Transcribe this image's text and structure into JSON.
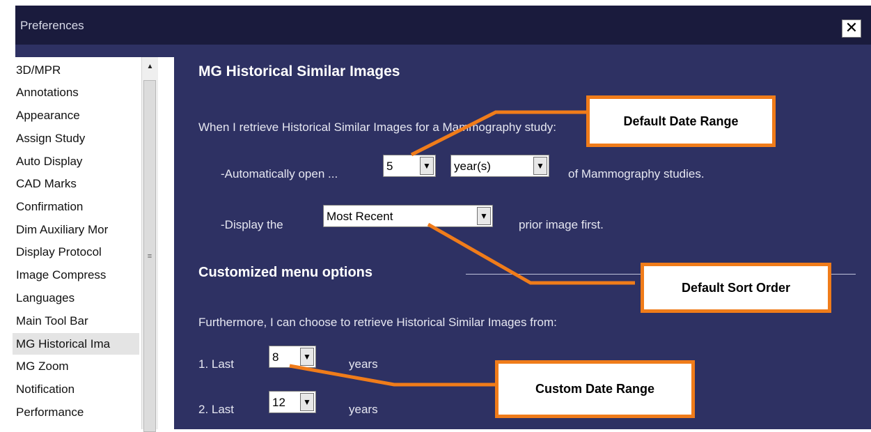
{
  "window": {
    "title": "Preferences",
    "close_label": "✕"
  },
  "sidebar": {
    "items": [
      {
        "label": "3D/MPR"
      },
      {
        "label": "Annotations"
      },
      {
        "label": "Appearance"
      },
      {
        "label": "Assign Study"
      },
      {
        "label": "Auto Display"
      },
      {
        "label": "CAD Marks"
      },
      {
        "label": "Confirmation"
      },
      {
        "label": "Dim Auxiliary Mor"
      },
      {
        "label": "Display Protocol"
      },
      {
        "label": "Image Compress"
      },
      {
        "label": "Languages"
      },
      {
        "label": "Main Tool Bar"
      },
      {
        "label": "MG Historical Ima",
        "selected": true
      },
      {
        "label": "MG Zoom"
      },
      {
        "label": "Notification"
      },
      {
        "label": "Performance"
      }
    ],
    "scroll_up_glyph": "▲",
    "grip_glyph": "≡"
  },
  "main": {
    "heading": "MG Historical Similar Images",
    "intro": "When I retrieve Historical Similar Images for a Mammography study:",
    "auto_open": {
      "prefix": "-Automatically open ...",
      "count": "5",
      "unit": "year(s)",
      "suffix": "of Mammography studies."
    },
    "display": {
      "prefix": "-Display the",
      "order": "Most Recent",
      "suffix": "prior image first."
    },
    "custom_heading": "Customized menu options",
    "furthermore": "Furthermore, I can choose to retrieve Historical Similar Images from:",
    "option1": {
      "prefix": "1. Last",
      "value": "8",
      "suffix": "years"
    },
    "option2": {
      "prefix": "2. Last",
      "value": "12",
      "suffix": "years"
    },
    "dropdown_glyph": "▼"
  },
  "callouts": {
    "default_date_range": "Default Date Range",
    "default_sort_order": "Default Sort Order",
    "custom_date_range": "Custom Date Range"
  },
  "colors": {
    "window_bg": "#2e3163",
    "titlebar_bg": "#1a1b3d",
    "callout_border": "#f07c1a"
  }
}
